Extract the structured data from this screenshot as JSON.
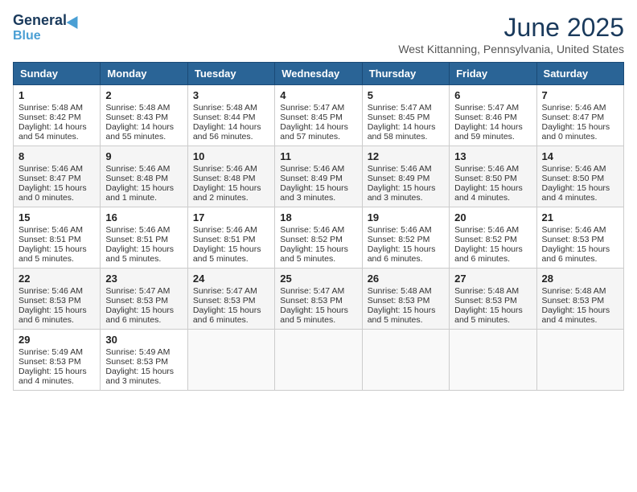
{
  "header": {
    "logo_line1": "General",
    "logo_line2": "Blue",
    "month": "June 2025",
    "location": "West Kittanning, Pennsylvania, United States"
  },
  "days_of_week": [
    "Sunday",
    "Monday",
    "Tuesday",
    "Wednesday",
    "Thursday",
    "Friday",
    "Saturday"
  ],
  "weeks": [
    [
      {
        "day": 1,
        "sunrise": "5:48 AM",
        "sunset": "8:42 PM",
        "daylight": "14 hours and 54 minutes."
      },
      {
        "day": 2,
        "sunrise": "5:48 AM",
        "sunset": "8:43 PM",
        "daylight": "14 hours and 55 minutes."
      },
      {
        "day": 3,
        "sunrise": "5:48 AM",
        "sunset": "8:44 PM",
        "daylight": "14 hours and 56 minutes."
      },
      {
        "day": 4,
        "sunrise": "5:47 AM",
        "sunset": "8:45 PM",
        "daylight": "14 hours and 57 minutes."
      },
      {
        "day": 5,
        "sunrise": "5:47 AM",
        "sunset": "8:45 PM",
        "daylight": "14 hours and 58 minutes."
      },
      {
        "day": 6,
        "sunrise": "5:47 AM",
        "sunset": "8:46 PM",
        "daylight": "14 hours and 59 minutes."
      },
      {
        "day": 7,
        "sunrise": "5:46 AM",
        "sunset": "8:47 PM",
        "daylight": "15 hours and 0 minutes."
      }
    ],
    [
      {
        "day": 8,
        "sunrise": "5:46 AM",
        "sunset": "8:47 PM",
        "daylight": "15 hours and 0 minutes."
      },
      {
        "day": 9,
        "sunrise": "5:46 AM",
        "sunset": "8:48 PM",
        "daylight": "15 hours and 1 minute."
      },
      {
        "day": 10,
        "sunrise": "5:46 AM",
        "sunset": "8:48 PM",
        "daylight": "15 hours and 2 minutes."
      },
      {
        "day": 11,
        "sunrise": "5:46 AM",
        "sunset": "8:49 PM",
        "daylight": "15 hours and 3 minutes."
      },
      {
        "day": 12,
        "sunrise": "5:46 AM",
        "sunset": "8:49 PM",
        "daylight": "15 hours and 3 minutes."
      },
      {
        "day": 13,
        "sunrise": "5:46 AM",
        "sunset": "8:50 PM",
        "daylight": "15 hours and 4 minutes."
      },
      {
        "day": 14,
        "sunrise": "5:46 AM",
        "sunset": "8:50 PM",
        "daylight": "15 hours and 4 minutes."
      }
    ],
    [
      {
        "day": 15,
        "sunrise": "5:46 AM",
        "sunset": "8:51 PM",
        "daylight": "15 hours and 5 minutes."
      },
      {
        "day": 16,
        "sunrise": "5:46 AM",
        "sunset": "8:51 PM",
        "daylight": "15 hours and 5 minutes."
      },
      {
        "day": 17,
        "sunrise": "5:46 AM",
        "sunset": "8:51 PM",
        "daylight": "15 hours and 5 minutes."
      },
      {
        "day": 18,
        "sunrise": "5:46 AM",
        "sunset": "8:52 PM",
        "daylight": "15 hours and 5 minutes."
      },
      {
        "day": 19,
        "sunrise": "5:46 AM",
        "sunset": "8:52 PM",
        "daylight": "15 hours and 6 minutes."
      },
      {
        "day": 20,
        "sunrise": "5:46 AM",
        "sunset": "8:52 PM",
        "daylight": "15 hours and 6 minutes."
      },
      {
        "day": 21,
        "sunrise": "5:46 AM",
        "sunset": "8:53 PM",
        "daylight": "15 hours and 6 minutes."
      }
    ],
    [
      {
        "day": 22,
        "sunrise": "5:46 AM",
        "sunset": "8:53 PM",
        "daylight": "15 hours and 6 minutes."
      },
      {
        "day": 23,
        "sunrise": "5:47 AM",
        "sunset": "8:53 PM",
        "daylight": "15 hours and 6 minutes."
      },
      {
        "day": 24,
        "sunrise": "5:47 AM",
        "sunset": "8:53 PM",
        "daylight": "15 hours and 6 minutes."
      },
      {
        "day": 25,
        "sunrise": "5:47 AM",
        "sunset": "8:53 PM",
        "daylight": "15 hours and 5 minutes."
      },
      {
        "day": 26,
        "sunrise": "5:48 AM",
        "sunset": "8:53 PM",
        "daylight": "15 hours and 5 minutes."
      },
      {
        "day": 27,
        "sunrise": "5:48 AM",
        "sunset": "8:53 PM",
        "daylight": "15 hours and 5 minutes."
      },
      {
        "day": 28,
        "sunrise": "5:48 AM",
        "sunset": "8:53 PM",
        "daylight": "15 hours and 4 minutes."
      }
    ],
    [
      {
        "day": 29,
        "sunrise": "5:49 AM",
        "sunset": "8:53 PM",
        "daylight": "15 hours and 4 minutes."
      },
      {
        "day": 30,
        "sunrise": "5:49 AM",
        "sunset": "8:53 PM",
        "daylight": "15 hours and 3 minutes."
      },
      null,
      null,
      null,
      null,
      null
    ]
  ]
}
